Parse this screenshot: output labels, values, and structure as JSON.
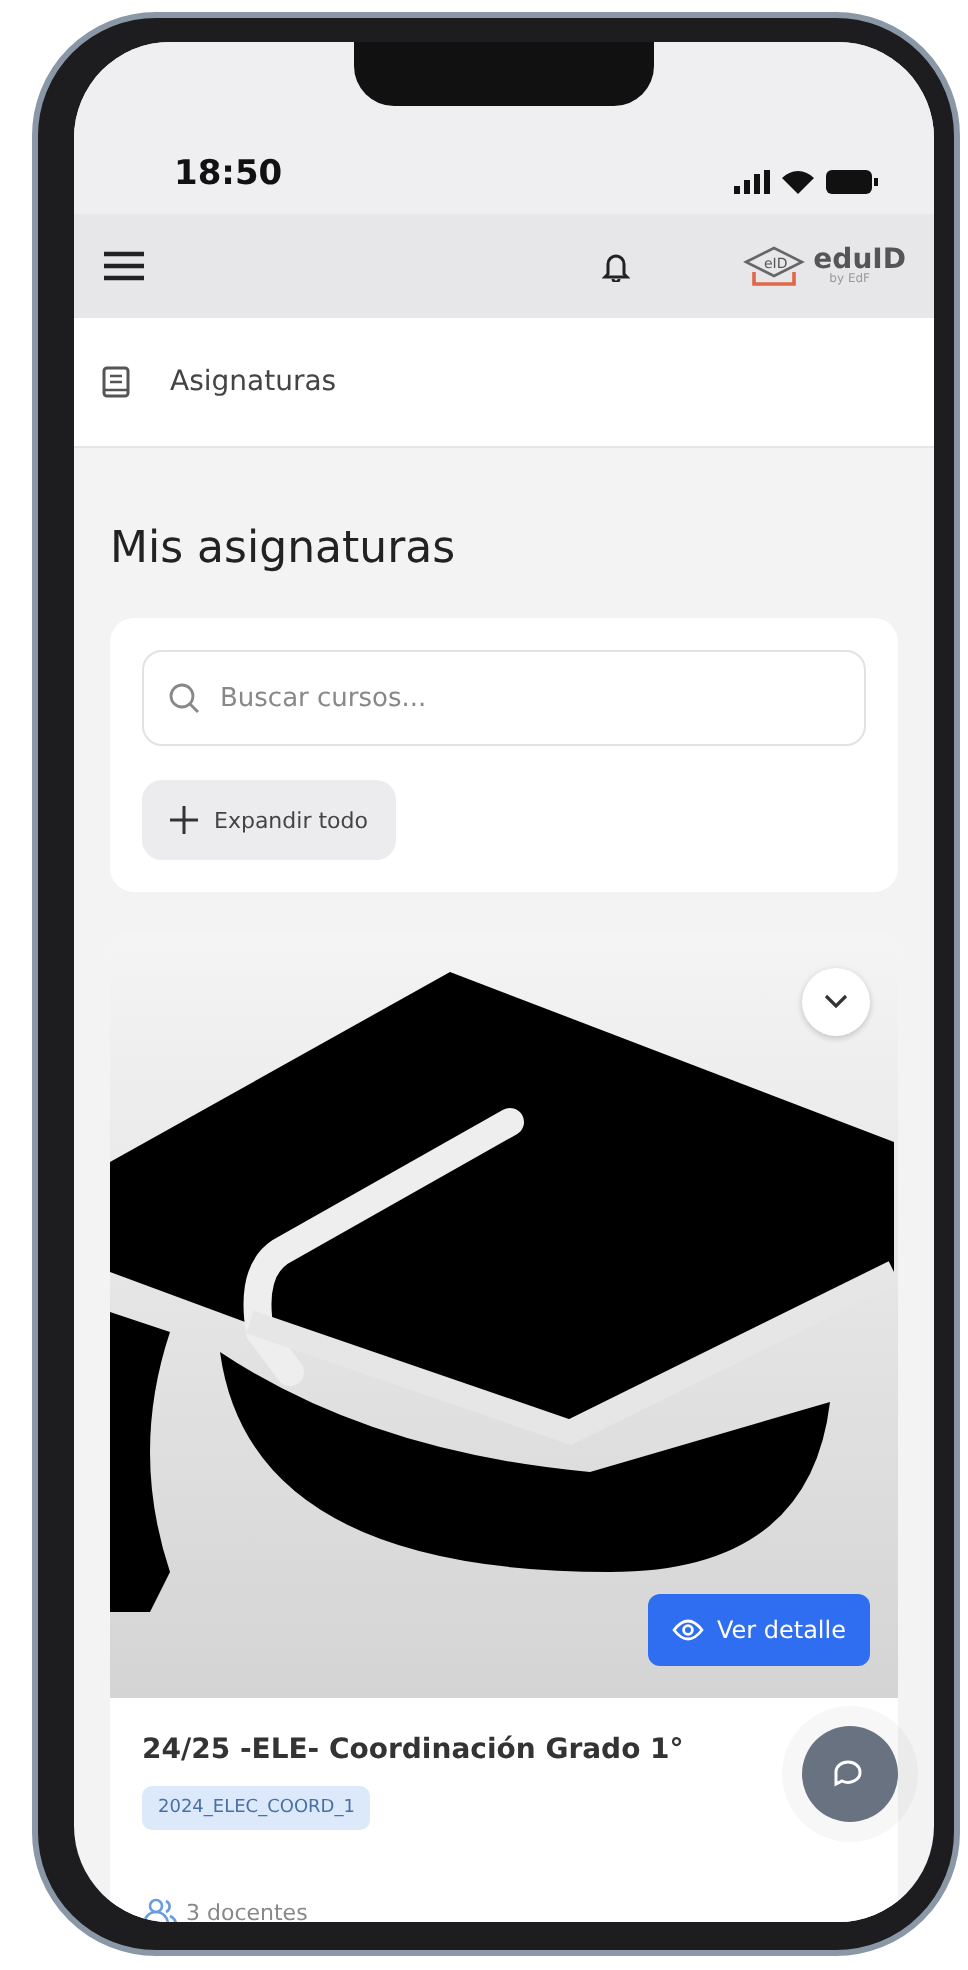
{
  "status_bar": {
    "time": "18:50"
  },
  "header": {
    "logo": {
      "mark": "eID",
      "name": "eduID",
      "subtitle": "by EdF"
    }
  },
  "breadcrumb": {
    "label": "Asignaturas"
  },
  "page_title": "Mis asignaturas",
  "search": {
    "placeholder": "Buscar cursos..."
  },
  "expand_button": {
    "label": "Expandir todo"
  },
  "courses": [
    {
      "title": "24/25 -ELE- Coordinación Grado 1°",
      "code": "2024_ELEC_COORD_1",
      "teachers": "3 docentes",
      "detail_button": "Ver detalle",
      "expanded": false
    }
  ]
}
